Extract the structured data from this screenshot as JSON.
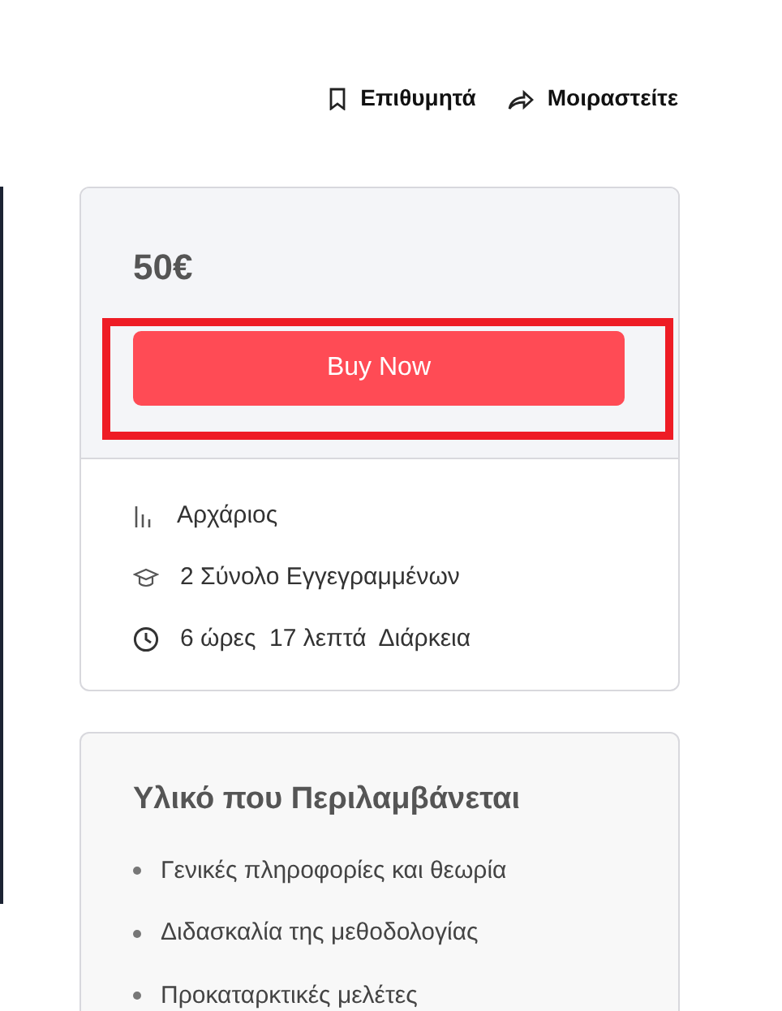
{
  "actions": [
    {
      "kind": "bookmark",
      "label": "Επιθυμητά"
    },
    {
      "kind": "share",
      "label": "Μοιραστείτε"
    }
  ],
  "price": "50€",
  "buy_button": {
    "label": "Buy Now",
    "highlighted": true
  },
  "info": [
    {
      "kind": "level",
      "text": "Αρχάριος"
    },
    {
      "kind": "enrolled",
      "text": "2 Σύνολο Εγγεγραμμένων"
    },
    {
      "kind": "duration",
      "text": "6 ώρες  17 λεπτά  Διάρκεια"
    }
  ],
  "materials": {
    "title": "Υλικό που Περιλαμβάνεται",
    "items": [
      "Γενικές πληροφορίες και θεωρία",
      "Διδασκαλία της μεθοδολογίας",
      "Προκαταρκτικές μελέτες"
    ]
  }
}
